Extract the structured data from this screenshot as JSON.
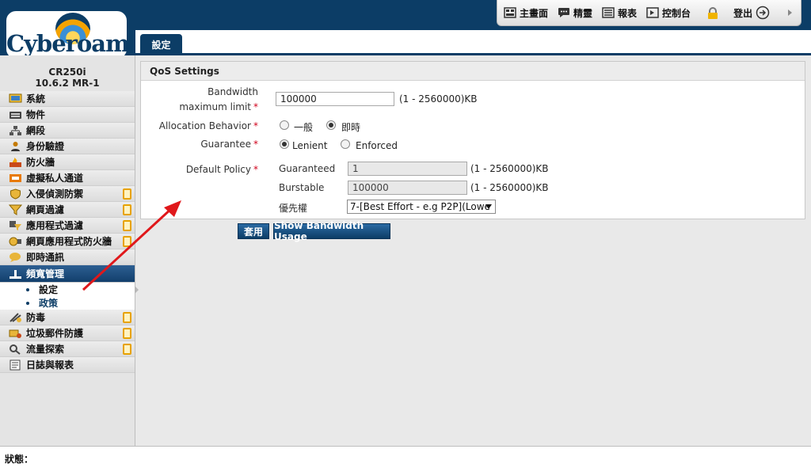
{
  "brand": {
    "logo_text": "Cyberoam"
  },
  "device": {
    "model": "CR250i",
    "version": "10.6.2 MR-1"
  },
  "toolbar": {
    "dashboard": "主畫面",
    "wizard": "精靈",
    "reports": "報表",
    "console": "控制台",
    "logout": "登出"
  },
  "sidebar": {
    "items": [
      {
        "label": "系統",
        "icon": "monitor-icon"
      },
      {
        "label": "物件",
        "icon": "keyboard-icon"
      },
      {
        "label": "網段",
        "icon": "network-icon"
      },
      {
        "label": "身份驗證",
        "icon": "users-icon"
      },
      {
        "label": "防火牆",
        "icon": "firewall-icon"
      },
      {
        "label": "虛擬私人通道",
        "icon": "vpn-icon"
      },
      {
        "label": "入侵偵測防禦",
        "icon": "shield-icon",
        "locked": true
      },
      {
        "label": "網頁過濾",
        "icon": "filter-icon",
        "locked": true
      },
      {
        "label": "應用程式過濾",
        "icon": "app-filter-icon",
        "locked": true
      },
      {
        "label": "網頁應用程式防火牆",
        "icon": "waf-icon",
        "locked": true
      },
      {
        "label": "即時通訊",
        "icon": "chat-icon"
      },
      {
        "label": "頻寬管理",
        "icon": "bandwidth-icon",
        "active": true
      }
    ],
    "sub_items": [
      {
        "label": "設定",
        "current": true
      },
      {
        "label": "政策"
      }
    ],
    "items_after": [
      {
        "label": "防毒",
        "icon": "antivirus-icon",
        "locked": true
      },
      {
        "label": "垃圾郵件防護",
        "icon": "antispam-icon",
        "locked": true
      },
      {
        "label": "流量探索",
        "icon": "traffic-search-icon",
        "locked": true
      },
      {
        "label": "日誌與報表",
        "icon": "logs-icon"
      }
    ]
  },
  "tab": {
    "label": "設定"
  },
  "qos": {
    "title": "QoS Settings",
    "bandwidth_label": "Bandwidth maximum limit",
    "bandwidth_value": "100000",
    "bandwidth_hint": "(1 - 2560000)KB",
    "allocation_label": "Allocation Behavior",
    "allocation_options": [
      "一般",
      "即時"
    ],
    "allocation_selected": "即時",
    "guarantee_label": "Guarantee",
    "guarantee_options": [
      "Lenient",
      "Enforced"
    ],
    "guarantee_selected": "Lenient",
    "default_policy_label": "Default Policy",
    "guaranteed_label": "Guaranteed",
    "guaranteed_value": "1",
    "guaranteed_hint": "(1 - 2560000)KB",
    "burstable_label": "Burstable",
    "burstable_value": "100000",
    "burstable_hint": "(1 - 2560000)KB",
    "priority_label": "優先權",
    "priority_value": "7-[Best Effort - e.g P2P](Lowe"
  },
  "buttons": {
    "apply": "套用",
    "show_usage": "Show Bandwidth Usage"
  },
  "status": {
    "label": "狀態："
  },
  "colors": {
    "brand_navy": "#0c3d66",
    "required_red": "#d0021b",
    "annotation_red": "#e0181b"
  }
}
